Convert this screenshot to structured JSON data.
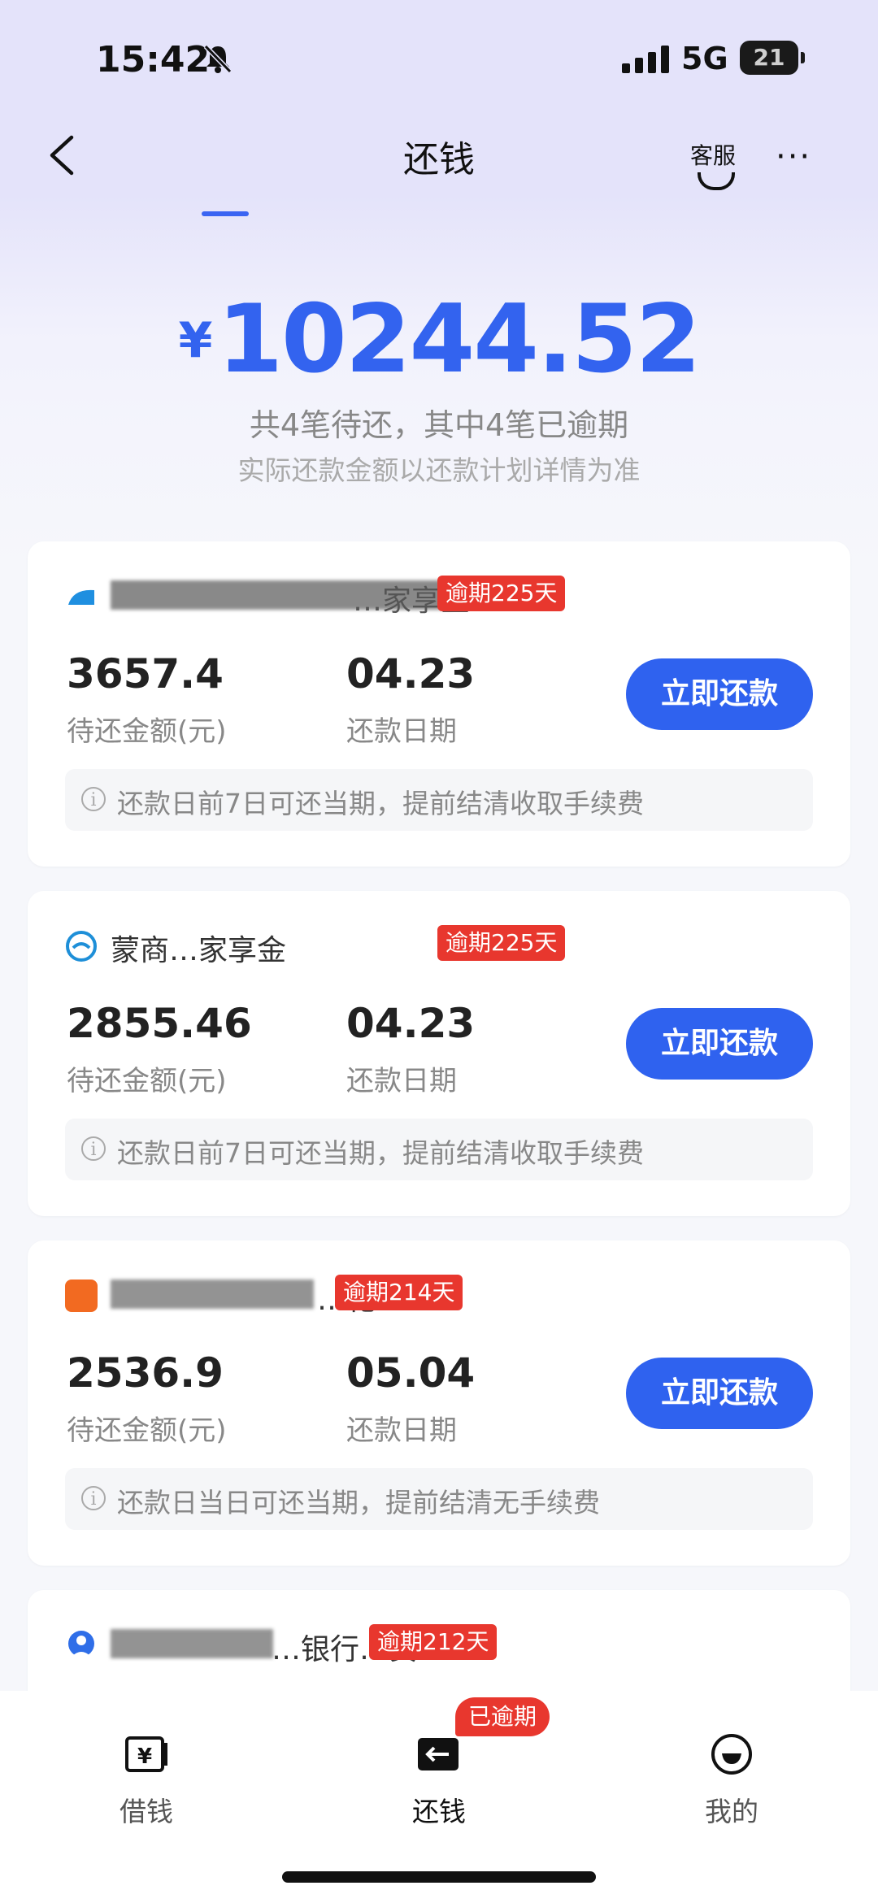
{
  "status_bar": {
    "time": "15:42",
    "network": "5G",
    "battery": "21"
  },
  "nav": {
    "title": "还钱",
    "customer_service": "客服",
    "more": "···"
  },
  "summary": {
    "currency": "¥",
    "total": "10244.52",
    "line1": "共4笔待还，其中4笔已逾期",
    "line2": "实际还款金额以还款计划详情为准"
  },
  "cards": [
    {
      "name": "…家享金",
      "overdue": "逾期225天",
      "amount": "3657.4",
      "amount_label": "待还金额(元)",
      "date": "04.23",
      "date_label": "还款日期",
      "button": "立即还款",
      "tip": "还款日前7日可还当期，提前结清收取手续费"
    },
    {
      "name": "蒙商…家享金",
      "overdue": "逾期225天",
      "amount": "2855.46",
      "amount_label": "待还金额(元)",
      "date": "04.23",
      "date_label": "还款日期",
      "button": "立即还款",
      "tip": "还款日前7日可还当期，提前结清收取手续费"
    },
    {
      "name": "…花",
      "overdue": "逾期214天",
      "amount": "2536.9",
      "amount_label": "待还金额(元)",
      "date": "05.04",
      "date_label": "还款日期",
      "button": "立即还款",
      "tip": "还款日当日可还当期，提前结清无手续费"
    },
    {
      "name": "…银行…贷",
      "overdue": "逾期212天"
    }
  ],
  "tabbar": {
    "borrow": "借钱",
    "repay": "还钱",
    "mine": "我的",
    "repay_badge": "已逾期"
  },
  "colors": {
    "accent": "#2f62ef",
    "overdue": "#e8372e"
  }
}
